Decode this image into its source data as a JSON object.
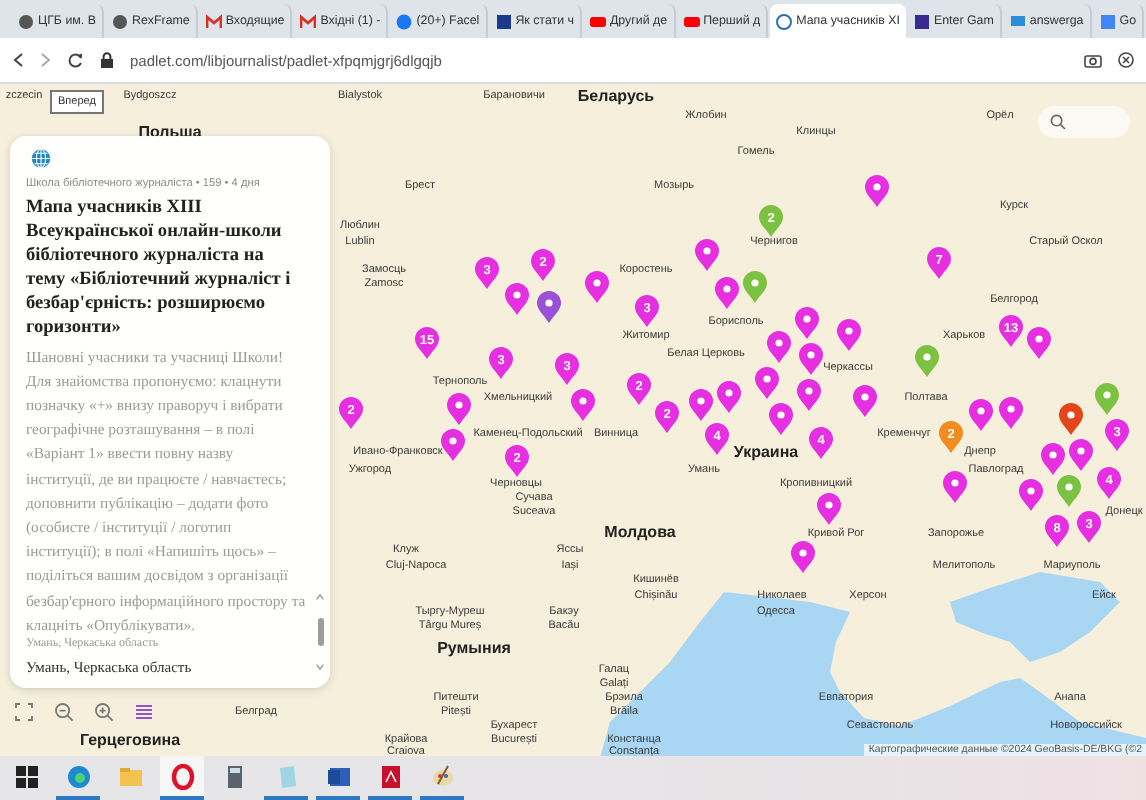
{
  "browser": {
    "tabs": [
      {
        "title": "ЦГБ им. В",
        "selected": false
      },
      {
        "title": "RexFrame",
        "selected": false
      },
      {
        "title": "Входящие",
        "selected": false
      },
      {
        "title": "Вхідні (1) -",
        "selected": false
      },
      {
        "title": "(20+) Facel",
        "selected": false
      },
      {
        "title": "Як стати ч",
        "selected": false
      },
      {
        "title": "Другий де",
        "selected": false
      },
      {
        "title": "Перший д",
        "selected": false
      },
      {
        "title": "Мапа учасників XI",
        "selected": true
      },
      {
        "title": "Enter Gam",
        "selected": false
      },
      {
        "title": "answerga",
        "selected": false
      },
      {
        "title": "Go",
        "selected": false
      }
    ],
    "address": "padlet.com/libjournalist/padlet-xfpqmjgrj6dlgqjb",
    "tooltip": "Вперед"
  },
  "post": {
    "meta": "Школа бібліотечного журналіста • 159 • 4 дня",
    "title": "Мапа учасників XIII Всеукраїнської онлайн-школи бібліотечного журналіста на тему «Бібліотечний журналіст і безбар'єрність: розширюємо горизонти»",
    "description": "Шановні учасники та учасниці Школи! Для знайомства пропонуємо: клацнути позначку «+» внизу праворуч і вибрати географічне розташування – в полі «Варіант 1» ввести повну назву інституції, де ви працюєте / навчаєтесь; доповнити публікацію – додати фото (особисте / інституції / логотип інституції); в полі «Напишіть щось» – поділіться вашим досвідом з організації безбар'єрного інформаційного простору та клацніть «Опублікувати».",
    "location_hint": "Умань, Черкаська область",
    "location": "Умань, Черкаська область"
  },
  "map": {
    "labels": [
      {
        "text": "zczecin",
        "kind": "city"
      },
      {
        "text": "Bydgoszcz",
        "kind": "city"
      },
      {
        "text": "Bialystok",
        "kind": "city"
      },
      {
        "text": "Барановичи",
        "kind": "city"
      },
      {
        "text": "Беларусь",
        "kind": "country"
      },
      {
        "text": "Жлобин",
        "kind": "city"
      },
      {
        "text": "Орёл",
        "kind": "city"
      },
      {
        "text": "Польша",
        "kind": "country"
      },
      {
        "text": "Клинцы",
        "kind": "city"
      },
      {
        "text": "Гомель",
        "kind": "city"
      },
      {
        "text": "Брест",
        "kind": "city"
      },
      {
        "text": "Мозырь",
        "kind": "city"
      },
      {
        "text": "Курск",
        "kind": "city"
      },
      {
        "text": "Люблин",
        "kind": "city"
      },
      {
        "text": "Lublin",
        "kind": "city"
      },
      {
        "text": "Чернигов",
        "kind": "city"
      },
      {
        "text": "Старый Оскол",
        "kind": "city"
      },
      {
        "text": "Замосць",
        "kind": "city"
      },
      {
        "text": "Коростень",
        "kind": "city"
      },
      {
        "text": "Zamosc",
        "kind": "city"
      },
      {
        "text": "Белгород",
        "kind": "city"
      },
      {
        "text": "Борисполь",
        "kind": "city"
      },
      {
        "text": "Житомир",
        "kind": "city"
      },
      {
        "text": "Харьков",
        "kind": "city"
      },
      {
        "text": "Белая Церковь",
        "kind": "city"
      },
      {
        "text": "Черкассы",
        "kind": "city"
      },
      {
        "text": "Тернополь",
        "kind": "city"
      },
      {
        "text": "Хмельницкий",
        "kind": "city"
      },
      {
        "text": "Полтава",
        "kind": "city"
      },
      {
        "text": "Каменец-Подольский",
        "kind": "city"
      },
      {
        "text": "Винница",
        "kind": "city"
      },
      {
        "text": "Кременчуг",
        "kind": "city"
      },
      {
        "text": "Ивано-Франковск",
        "kind": "city"
      },
      {
        "text": "Украина",
        "kind": "country"
      },
      {
        "text": "Днепр",
        "kind": "city"
      },
      {
        "text": "Ужгород",
        "kind": "city"
      },
      {
        "text": "Умань",
        "kind": "city"
      },
      {
        "text": "Павлоград",
        "kind": "city"
      },
      {
        "text": "Черновцы",
        "kind": "city"
      },
      {
        "text": "Кропивницкий",
        "kind": "city"
      },
      {
        "text": "Сучава",
        "kind": "city"
      },
      {
        "text": "Suceava",
        "kind": "city"
      },
      {
        "text": "Донецк",
        "kind": "city"
      },
      {
        "text": "Молдова",
        "kind": "country"
      },
      {
        "text": "Кривой Рог",
        "kind": "city"
      },
      {
        "text": "Запорожье",
        "kind": "city"
      },
      {
        "text": "Клуж",
        "kind": "city"
      },
      {
        "text": "Яссы",
        "kind": "city"
      },
      {
        "text": "Cluj-Napoca",
        "kind": "city"
      },
      {
        "text": "Iași",
        "kind": "city"
      },
      {
        "text": "Мелитополь",
        "kind": "city"
      },
      {
        "text": "Мариуполь",
        "kind": "city"
      },
      {
        "text": "Кишинёв",
        "kind": "city"
      },
      {
        "text": "Chișinău",
        "kind": "city"
      },
      {
        "text": "Николаев",
        "kind": "city"
      },
      {
        "text": "Херсон",
        "kind": "city"
      },
      {
        "text": "Ейск",
        "kind": "city"
      },
      {
        "text": "Тыргу-Муреш",
        "kind": "city"
      },
      {
        "text": "Бакэу",
        "kind": "city"
      },
      {
        "text": "Одесса",
        "kind": "city"
      },
      {
        "text": "Târgu Mureș",
        "kind": "city"
      },
      {
        "text": "Bacău",
        "kind": "city"
      },
      {
        "text": "Румыния",
        "kind": "country"
      },
      {
        "text": "Галац",
        "kind": "city"
      },
      {
        "text": "Galați",
        "kind": "city"
      },
      {
        "text": "Питешти",
        "kind": "city"
      },
      {
        "text": "Брэила",
        "kind": "city"
      },
      {
        "text": "Евпатория",
        "kind": "city"
      },
      {
        "text": "Анапа",
        "kind": "city"
      },
      {
        "text": "Белград",
        "kind": "city"
      },
      {
        "text": "Pitești",
        "kind": "city"
      },
      {
        "text": "Brăila",
        "kind": "city"
      },
      {
        "text": "Бухарест",
        "kind": "city"
      },
      {
        "text": "Севастополь",
        "kind": "city"
      },
      {
        "text": "Новороссийск",
        "kind": "city"
      },
      {
        "text": "Герцеговина",
        "kind": "country"
      },
      {
        "text": "Крайова",
        "kind": "city"
      },
      {
        "text": "București",
        "kind": "city"
      },
      {
        "text": "Констанца",
        "kind": "city"
      },
      {
        "text": "Craiova",
        "kind": "city"
      },
      {
        "text": "Constanța",
        "kind": "city"
      }
    ],
    "pins": [
      {
        "color": "#e52fe0"
      },
      {
        "color": "#7cc242",
        "count": "2"
      },
      {
        "color": "#e52fe0"
      },
      {
        "color": "#e52fe0",
        "count": "7"
      },
      {
        "color": "#e52fe0",
        "count": "2"
      },
      {
        "color": "#e52fe0",
        "count": "3"
      },
      {
        "color": "#7cc242"
      },
      {
        "color": "#e52fe0"
      },
      {
        "color": "#e52fe0"
      },
      {
        "color": "#e52fe0"
      },
      {
        "color": "#9b51d6"
      },
      {
        "color": "#e52fe0",
        "count": "3"
      },
      {
        "color": "#e52fe0"
      },
      {
        "color": "#e52fe0",
        "count": "13"
      },
      {
        "color": "#e52fe0"
      },
      {
        "color": "#e52fe0",
        "count": "15"
      },
      {
        "color": "#e52fe0"
      },
      {
        "color": "#e52fe0",
        "count": "3"
      },
      {
        "color": "#e52fe0"
      },
      {
        "color": "#e52fe0",
        "count": "3"
      },
      {
        "color": "#e52fe0"
      },
      {
        "color": "#7cc242"
      },
      {
        "color": "#e52fe0",
        "count": "2"
      },
      {
        "color": "#7cc242"
      },
      {
        "color": "#e52fe0"
      },
      {
        "color": "#e52fe0"
      },
      {
        "color": "#e52fe0"
      },
      {
        "color": "#e52fe0"
      },
      {
        "color": "#e52fe0",
        "count": "2"
      },
      {
        "color": "#e52fe0",
        "count": "2"
      },
      {
        "color": "#e52fe0"
      },
      {
        "color": "#e52fe0"
      },
      {
        "color": "#e52fe0"
      },
      {
        "color": "#e4461c"
      },
      {
        "color": "#e52fe0"
      },
      {
        "color": "#e52fe0",
        "count": "4"
      },
      {
        "color": "#f28c1c",
        "count": "2"
      },
      {
        "color": "#e52fe0",
        "count": "4"
      },
      {
        "color": "#e52fe0"
      },
      {
        "color": "#e52fe0"
      },
      {
        "color": "#e52fe0"
      },
      {
        "color": "#e52fe0",
        "count": "2"
      },
      {
        "color": "#e52fe0"
      },
      {
        "color": "#e52fe0",
        "count": "3"
      },
      {
        "color": "#7cc242"
      },
      {
        "color": "#e52fe0"
      },
      {
        "color": "#e52fe0"
      },
      {
        "color": "#e52fe0"
      },
      {
        "color": "#e52fe0"
      },
      {
        "color": "#e52fe0",
        "count": "4"
      },
      {
        "color": "#e52fe0",
        "count": "3"
      },
      {
        "color": "#e52fe0",
        "count": "8"
      },
      {
        "color": "#e52fe0"
      }
    ],
    "attribution": "Картографические данные ©2024 GeoBasis-DE/BKG (©2"
  },
  "taskbar": {
    "apps": [
      {
        "running": false,
        "selected": false
      },
      {
        "running": true,
        "selected": false
      },
      {
        "running": false,
        "selected": false
      },
      {
        "running": true,
        "selected": true
      },
      {
        "running": false,
        "selected": false
      },
      {
        "running": true,
        "selected": false
      },
      {
        "running": true,
        "selected": false
      },
      {
        "running": true,
        "selected": false
      },
      {
        "running": true,
        "selected": false
      }
    ]
  }
}
